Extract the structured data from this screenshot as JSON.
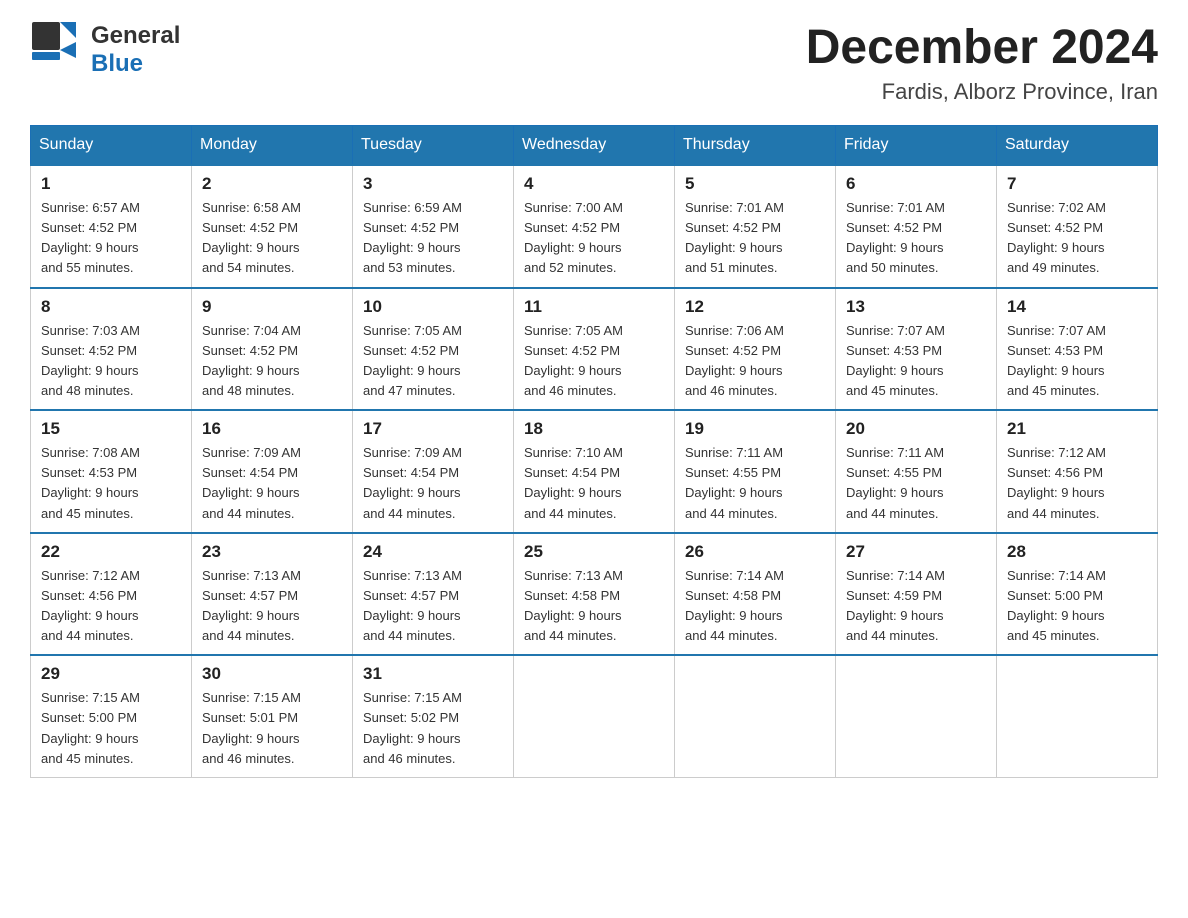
{
  "header": {
    "logo_general": "General",
    "logo_blue": "Blue",
    "month_title": "December 2024",
    "location": "Fardis, Alborz Province, Iran"
  },
  "calendar": {
    "days_of_week": [
      "Sunday",
      "Monday",
      "Tuesday",
      "Wednesday",
      "Thursday",
      "Friday",
      "Saturday"
    ],
    "weeks": [
      [
        {
          "num": "1",
          "sunrise": "6:57 AM",
          "sunset": "4:52 PM",
          "daylight": "9 hours and 55 minutes."
        },
        {
          "num": "2",
          "sunrise": "6:58 AM",
          "sunset": "4:52 PM",
          "daylight": "9 hours and 54 minutes."
        },
        {
          "num": "3",
          "sunrise": "6:59 AM",
          "sunset": "4:52 PM",
          "daylight": "9 hours and 53 minutes."
        },
        {
          "num": "4",
          "sunrise": "7:00 AM",
          "sunset": "4:52 PM",
          "daylight": "9 hours and 52 minutes."
        },
        {
          "num": "5",
          "sunrise": "7:01 AM",
          "sunset": "4:52 PM",
          "daylight": "9 hours and 51 minutes."
        },
        {
          "num": "6",
          "sunrise": "7:01 AM",
          "sunset": "4:52 PM",
          "daylight": "9 hours and 50 minutes."
        },
        {
          "num": "7",
          "sunrise": "7:02 AM",
          "sunset": "4:52 PM",
          "daylight": "9 hours and 49 minutes."
        }
      ],
      [
        {
          "num": "8",
          "sunrise": "7:03 AM",
          "sunset": "4:52 PM",
          "daylight": "9 hours and 48 minutes."
        },
        {
          "num": "9",
          "sunrise": "7:04 AM",
          "sunset": "4:52 PM",
          "daylight": "9 hours and 48 minutes."
        },
        {
          "num": "10",
          "sunrise": "7:05 AM",
          "sunset": "4:52 PM",
          "daylight": "9 hours and 47 minutes."
        },
        {
          "num": "11",
          "sunrise": "7:05 AM",
          "sunset": "4:52 PM",
          "daylight": "9 hours and 46 minutes."
        },
        {
          "num": "12",
          "sunrise": "7:06 AM",
          "sunset": "4:52 PM",
          "daylight": "9 hours and 46 minutes."
        },
        {
          "num": "13",
          "sunrise": "7:07 AM",
          "sunset": "4:53 PM",
          "daylight": "9 hours and 45 minutes."
        },
        {
          "num": "14",
          "sunrise": "7:07 AM",
          "sunset": "4:53 PM",
          "daylight": "9 hours and 45 minutes."
        }
      ],
      [
        {
          "num": "15",
          "sunrise": "7:08 AM",
          "sunset": "4:53 PM",
          "daylight": "9 hours and 45 minutes."
        },
        {
          "num": "16",
          "sunrise": "7:09 AM",
          "sunset": "4:54 PM",
          "daylight": "9 hours and 44 minutes."
        },
        {
          "num": "17",
          "sunrise": "7:09 AM",
          "sunset": "4:54 PM",
          "daylight": "9 hours and 44 minutes."
        },
        {
          "num": "18",
          "sunrise": "7:10 AM",
          "sunset": "4:54 PM",
          "daylight": "9 hours and 44 minutes."
        },
        {
          "num": "19",
          "sunrise": "7:11 AM",
          "sunset": "4:55 PM",
          "daylight": "9 hours and 44 minutes."
        },
        {
          "num": "20",
          "sunrise": "7:11 AM",
          "sunset": "4:55 PM",
          "daylight": "9 hours and 44 minutes."
        },
        {
          "num": "21",
          "sunrise": "7:12 AM",
          "sunset": "4:56 PM",
          "daylight": "9 hours and 44 minutes."
        }
      ],
      [
        {
          "num": "22",
          "sunrise": "7:12 AM",
          "sunset": "4:56 PM",
          "daylight": "9 hours and 44 minutes."
        },
        {
          "num": "23",
          "sunrise": "7:13 AM",
          "sunset": "4:57 PM",
          "daylight": "9 hours and 44 minutes."
        },
        {
          "num": "24",
          "sunrise": "7:13 AM",
          "sunset": "4:57 PM",
          "daylight": "9 hours and 44 minutes."
        },
        {
          "num": "25",
          "sunrise": "7:13 AM",
          "sunset": "4:58 PM",
          "daylight": "9 hours and 44 minutes."
        },
        {
          "num": "26",
          "sunrise": "7:14 AM",
          "sunset": "4:58 PM",
          "daylight": "9 hours and 44 minutes."
        },
        {
          "num": "27",
          "sunrise": "7:14 AM",
          "sunset": "4:59 PM",
          "daylight": "9 hours and 44 minutes."
        },
        {
          "num": "28",
          "sunrise": "7:14 AM",
          "sunset": "5:00 PM",
          "daylight": "9 hours and 45 minutes."
        }
      ],
      [
        {
          "num": "29",
          "sunrise": "7:15 AM",
          "sunset": "5:00 PM",
          "daylight": "9 hours and 45 minutes."
        },
        {
          "num": "30",
          "sunrise": "7:15 AM",
          "sunset": "5:01 PM",
          "daylight": "9 hours and 46 minutes."
        },
        {
          "num": "31",
          "sunrise": "7:15 AM",
          "sunset": "5:02 PM",
          "daylight": "9 hours and 46 minutes."
        },
        null,
        null,
        null,
        null
      ]
    ],
    "sunrise_label": "Sunrise: ",
    "sunset_label": "Sunset: ",
    "daylight_label": "Daylight: "
  }
}
